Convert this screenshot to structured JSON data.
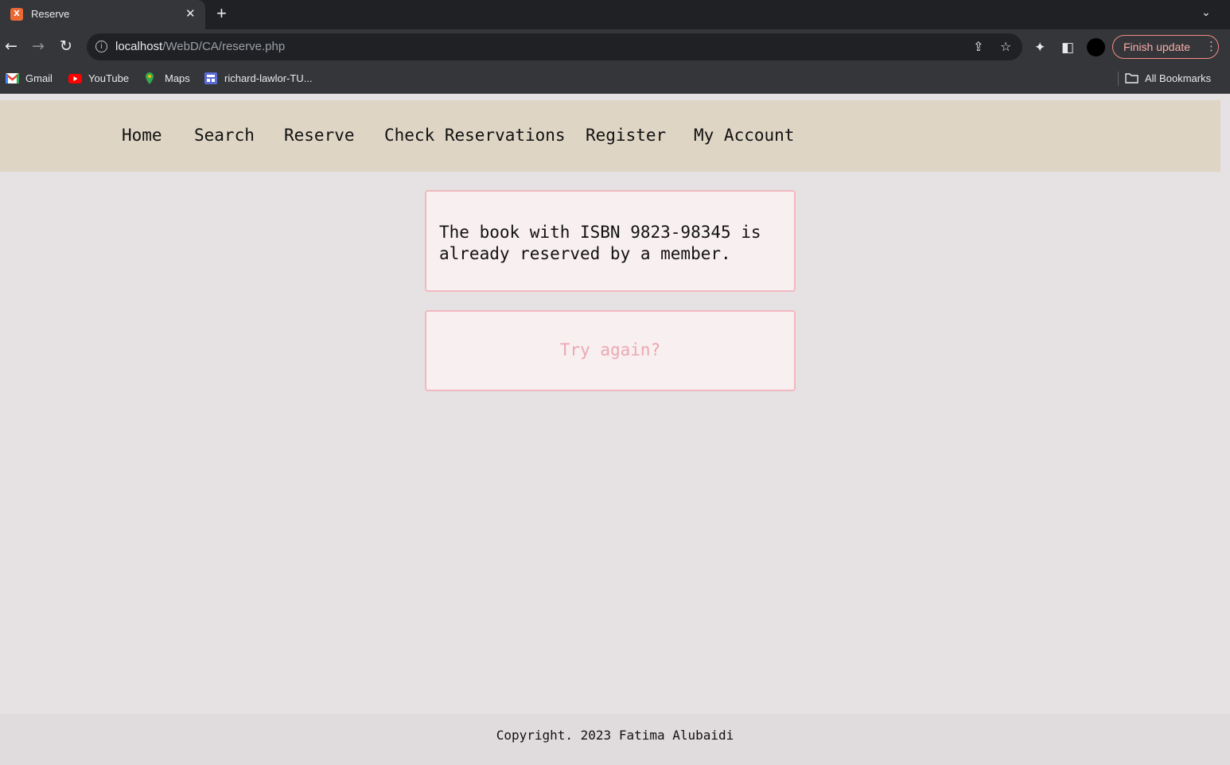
{
  "browser": {
    "tab": {
      "title": "Reserve"
    },
    "address": {
      "host": "localhost",
      "path": "/WebD/CA/reserve.php"
    },
    "update_button": "Finish update",
    "bookmarks": [
      {
        "label": "Gmail",
        "icon": "gmail-icon"
      },
      {
        "label": "YouTube",
        "icon": "youtube-icon"
      },
      {
        "label": "Maps",
        "icon": "maps-icon"
      },
      {
        "label": "richard-lawlor-TU...",
        "icon": "site-icon"
      }
    ],
    "all_bookmarks": "All Bookmarks"
  },
  "nav": {
    "items": [
      {
        "label": "Home"
      },
      {
        "label": "Search"
      },
      {
        "label": "Reserve"
      },
      {
        "label": "Check Reservations"
      },
      {
        "label": "Register"
      },
      {
        "label": "My Account"
      }
    ]
  },
  "message": {
    "text": "The book with ISBN 9823-98345 is already reserved by a member."
  },
  "retry": {
    "label": "Try again?"
  },
  "footer": {
    "text": "Copyright. 2023 Fatima Alubaidi"
  },
  "colors": {
    "nav_bg": "#ded5c5",
    "page_bg": "#e6e1e2",
    "box_border": "#f2b8c0",
    "box_bg": "#f8eff0",
    "retry_text": "#eba8b2"
  }
}
